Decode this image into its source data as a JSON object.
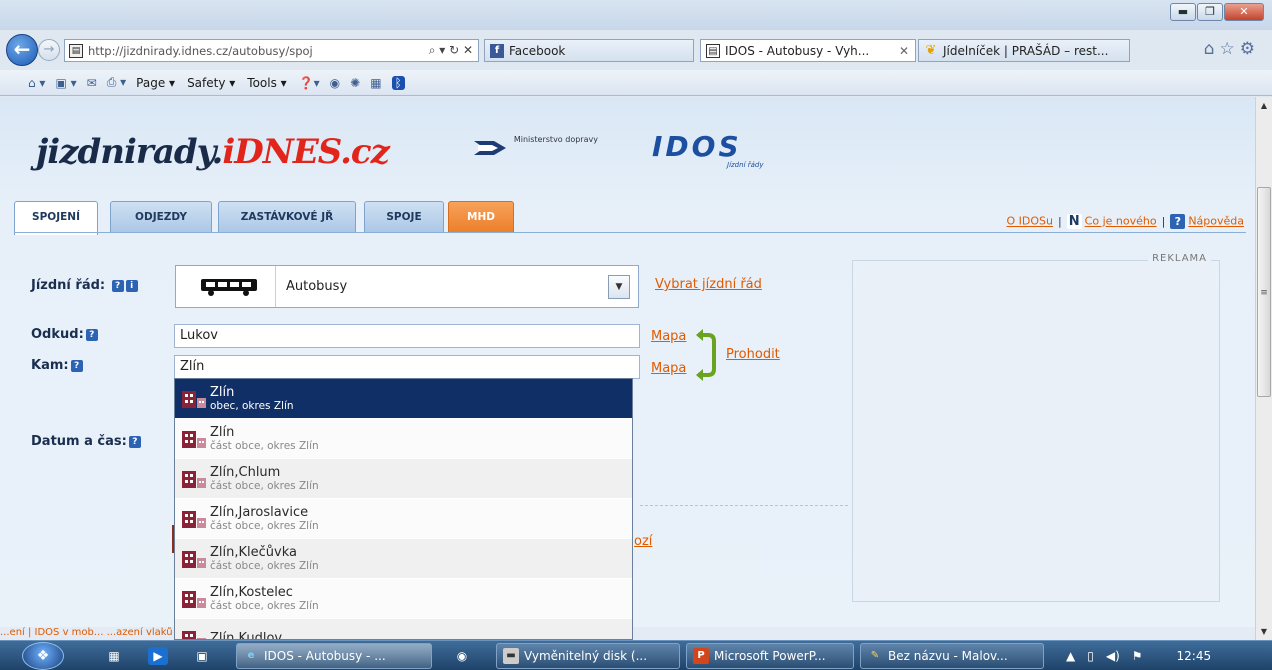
{
  "browser": {
    "url": "http://jizdnirady.idnes.cz/autobusy/spoj",
    "addr_controls": "⌕ ▾ ↻ ✕",
    "tabs": [
      {
        "label": "Facebook"
      },
      {
        "label": "IDOS - Autobusy - Vyh...",
        "close": "✕"
      },
      {
        "label": "Jídelníček | PRAŠÁD – rest..."
      }
    ],
    "commands": [
      "Page ▾",
      "Safety ▾",
      "Tools ▾"
    ]
  },
  "header": {
    "logo_left": "jizdnirady.",
    "logo_right": "iDNES.cz",
    "ministry": "Ministerstvo dopravy",
    "idos": "IDOS",
    "idos_sub": "Jízdní řády"
  },
  "tabs": [
    "SPOJENÍ",
    "ODJEZDY",
    "ZASTÁVKOVÉ JŘ",
    "SPOJE",
    "MHD"
  ],
  "top_links": {
    "about": "O IDOSu",
    "news": "Co je nového",
    "help": "Nápověda"
  },
  "form": {
    "timetable_label": "Jízdní řád:",
    "timetable_value": "Autobusy",
    "choose_timetable": "Vybrat jízdní řád",
    "from_label": "Odkud:",
    "from_value": "Lukov",
    "to_label": "Kam:",
    "to_value": "Zlín",
    "map_label": "Mapa",
    "swap_label": "Prohodit",
    "datetime_label": "Datum a čas:",
    "hidden_link": "ozí"
  },
  "ad": {
    "label": "REKLAMA"
  },
  "autocomplete": [
    {
      "name": "Zlín",
      "desc": "obec, okres Zlín",
      "selected": true
    },
    {
      "name": "Zlín",
      "desc": "část obce, okres Zlín"
    },
    {
      "name": "Zlín,Chlum",
      "desc": "část obce, okres Zlín"
    },
    {
      "name": "Zlín,Jaroslavice",
      "desc": "část obce, okres Zlín"
    },
    {
      "name": "Zlín,Klečůvka",
      "desc": "část obce, okres Zlín"
    },
    {
      "name": "Zlín,Kostelec",
      "desc": "část obce, okres Zlín"
    },
    {
      "name": "Zlín,Kudlov",
      "desc": ""
    }
  ],
  "footer": {
    "text": "...ení  |  IDOS v mob...                                                                               ...azení vlaků  |  Pro nevidomé  |  Facebook"
  },
  "taskbar": {
    "tasks": [
      "IDOS - Autobusy - ...",
      "Vyměnitelný disk (...",
      "Microsoft PowerP...",
      "Bez názvu - Malov..."
    ],
    "time": "12:45"
  }
}
